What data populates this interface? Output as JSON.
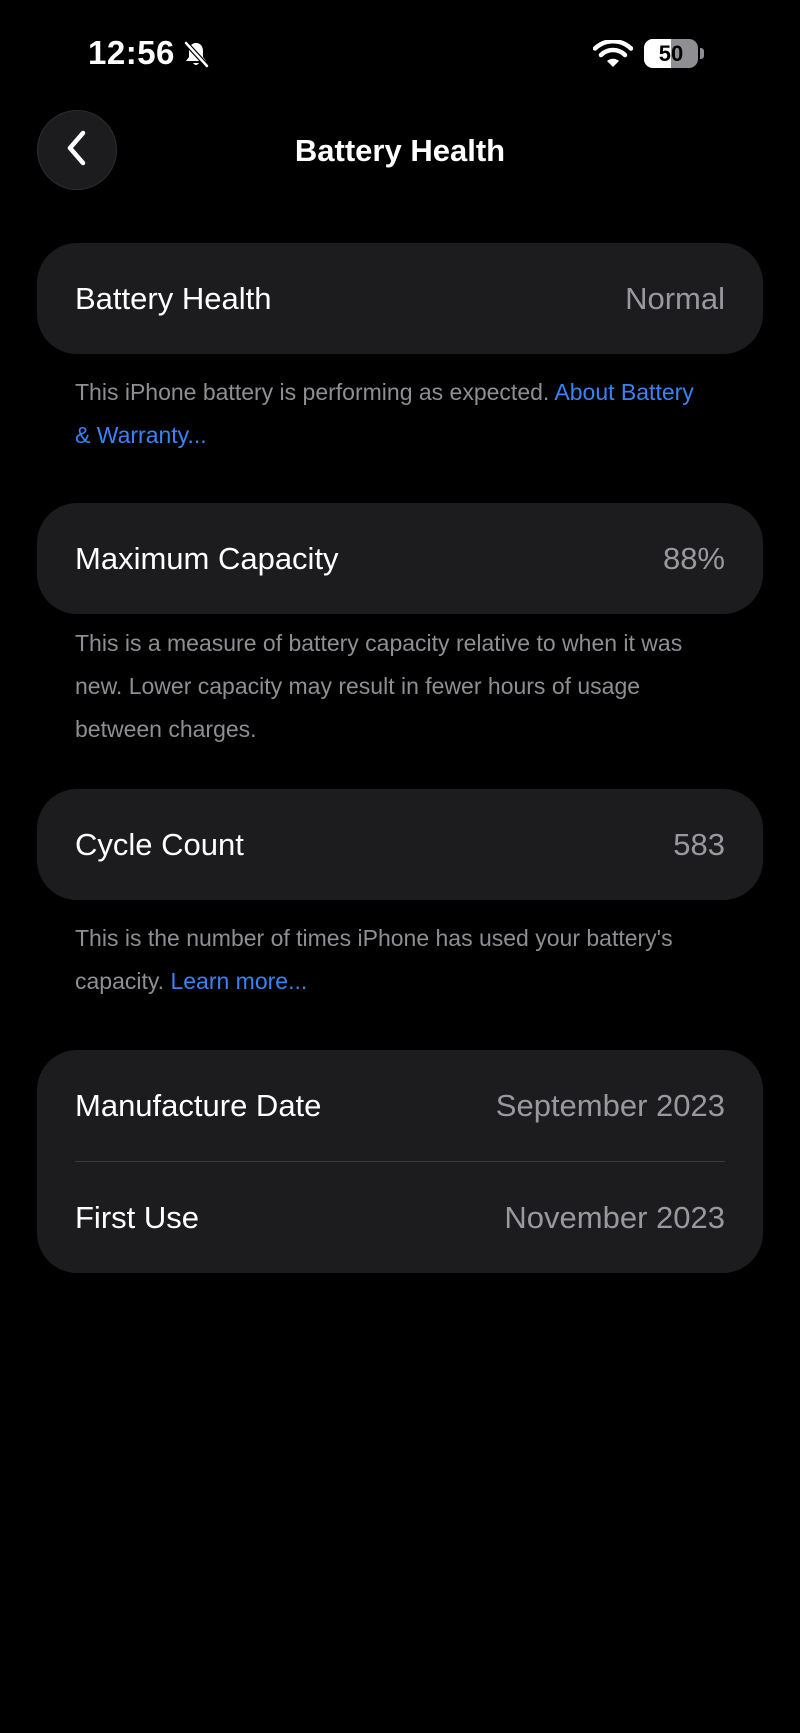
{
  "status_bar": {
    "time": "12:56",
    "battery_level": "50",
    "battery_fraction": 0.5,
    "icons": [
      "bell-slash-icon",
      "wifi-icon",
      "battery-icon"
    ]
  },
  "nav": {
    "back_icon": "chevron-left-icon",
    "title": "Battery Health"
  },
  "battery_health": {
    "label": "Battery Health",
    "value": "Normal",
    "footnote": "This iPhone battery is performing as expected.",
    "link": "About Battery & Warranty..."
  },
  "maximum_capacity": {
    "label": "Maximum Capacity",
    "value": "88%",
    "footnote": "This is a measure of battery capacity relative to when it was new. Lower capacity may result in fewer hours of usage between charges."
  },
  "cycle_count": {
    "label": "Cycle Count",
    "value": "583",
    "footnote": "This is the number of times iPhone has used your battery's capacity.",
    "link": "Learn more..."
  },
  "dates": {
    "manufacture_label": "Manufacture Date",
    "manufacture_value": "September 2023",
    "first_use_label": "First Use",
    "first_use_value": "November 2023"
  },
  "colors": {
    "background": "#000000",
    "card": "#1c1c1e",
    "secondary_text": "#8e8e93",
    "link": "#3b82f6"
  }
}
